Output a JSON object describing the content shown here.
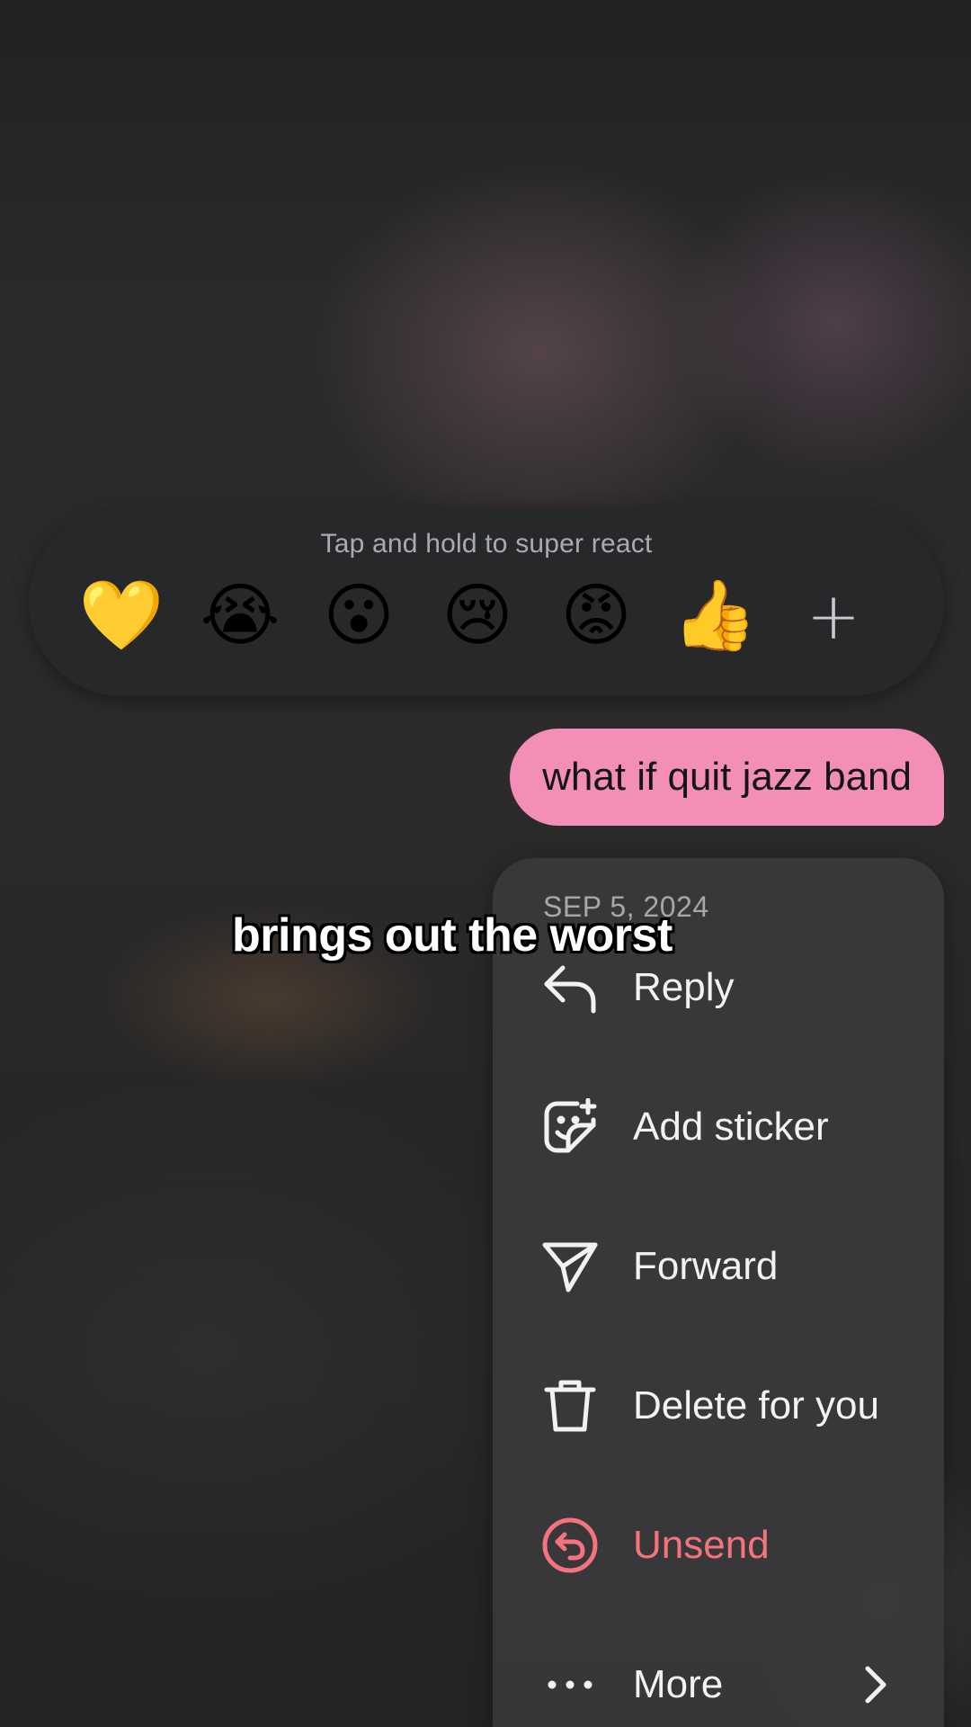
{
  "reactions": {
    "hint": "Tap and hold to super react",
    "emojis": [
      {
        "glyph": "💛",
        "name": "yellow-heart"
      },
      {
        "glyph": "😭",
        "name": "loudly-crying-face"
      },
      {
        "glyph": "😮",
        "name": "face-with-open-mouth"
      },
      {
        "glyph": "😢",
        "name": "crying-face"
      },
      {
        "glyph": "😡",
        "name": "angry-face"
      },
      {
        "glyph": "👍",
        "name": "thumbs-up"
      }
    ],
    "more_glyph": "+"
  },
  "message": {
    "text": "what if quit jazz band",
    "bubble_color": "#f38fb6"
  },
  "menu": {
    "date": "SEP 5, 2024",
    "items": [
      {
        "label": "Reply",
        "icon": "reply-icon"
      },
      {
        "label": "Add sticker",
        "icon": "sticker-icon"
      },
      {
        "label": "Forward",
        "icon": "forward-icon"
      },
      {
        "label": "Delete for you",
        "icon": "trash-icon"
      },
      {
        "label": "Unsend",
        "icon": "unsend-icon",
        "color": "#f5737e"
      },
      {
        "label": "More",
        "icon": "more-icon"
      }
    ]
  },
  "caption": {
    "text": "brings out the worst"
  }
}
